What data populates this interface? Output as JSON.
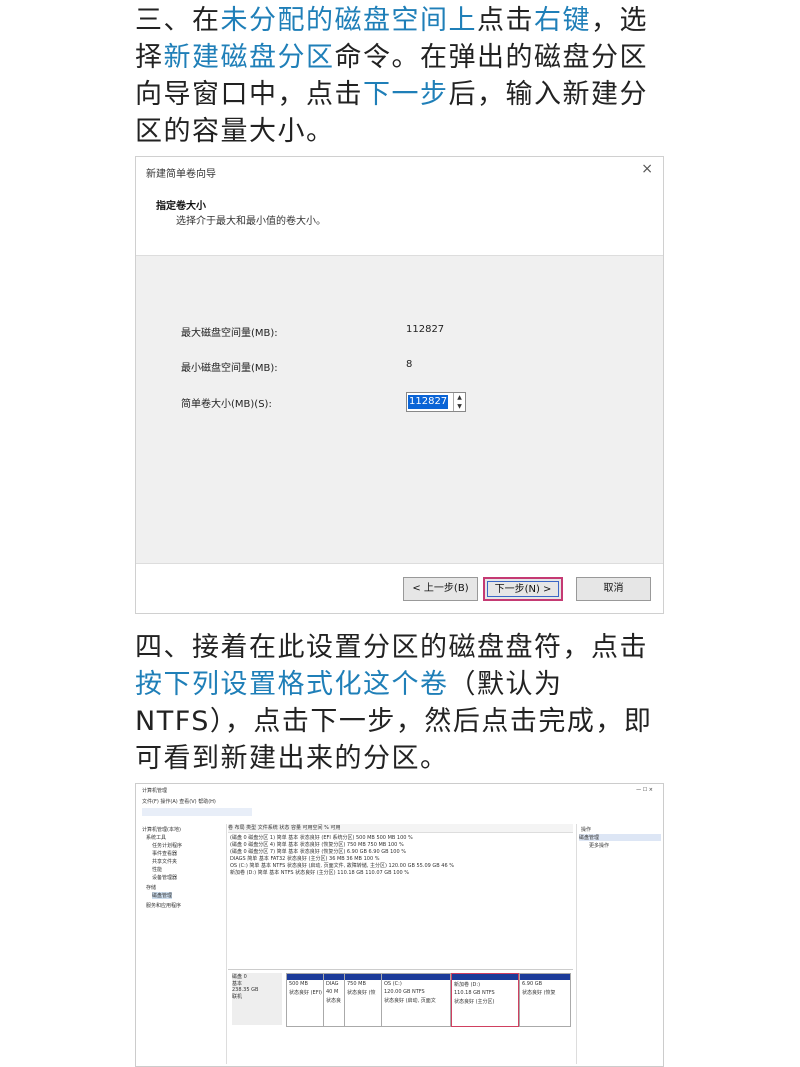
{
  "para1": {
    "s1": "三、在",
    "h1": "未分配的磁盘空间上",
    "s2": "点击",
    "h2": "右键",
    "s3": "，选择",
    "h3": "新建磁盘分区",
    "s4": "命令。在弹出的磁盘分区向导窗口中，点击",
    "h4": "下一步",
    "s5": "后，输入新建分区的容量大小。"
  },
  "dialog": {
    "title": "新建简单卷向导",
    "close": "×",
    "heading": "指定卷大小",
    "desc": "选择介于最大和最小值的卷大小。",
    "max_label": "最大磁盘空间量(MB):",
    "max_value": "112827",
    "min_label": "最小磁盘空间量(MB):",
    "min_value": "8",
    "size_label": "简单卷大小(MB)(S):",
    "size_value": "112827",
    "back": "< 上一步(B)",
    "next": "下一步(N) >",
    "cancel": "取消"
  },
  "para2": {
    "s1": "四、接着在此设置分区的磁盘盘符，点击",
    "h1": "按下列设置格式化这个卷",
    "s2": "（默认为NTFS），点击下一步，然后点击完成，即可看到新建出来的分区。"
  },
  "diskmgmt": {
    "title": "计算机管理",
    "menu": "文件(F)  操作(A)  查看(V)  帮助(H)",
    "tree": [
      "计算机管理(本地)",
      "系统工具",
      "任务计划程序",
      "事件查看器",
      "共享文件夹",
      "性能",
      "设备管理器",
      "存储",
      "磁盘管理",
      "服务和应用程序"
    ],
    "cols": "卷  布局  类型  文件系统  状态  容量  可用空间  % 可用",
    "rows": [
      "(磁盘 0 磁盘分区 1)  简单  基本    状态良好 (EFI 系统分区)  500 MB  500 MB  100 %",
      "(磁盘 0 磁盘分区 4)  简单  基本    状态良好 (恢复分区)  750 MB  750 MB  100 %",
      "(磁盘 0 磁盘分区 7)  简单  基本    状态良好 (恢复分区)  6.90 GB  6.90 GB  100 %",
      "DIAGS  简单  基本  FAT32  状态良好 (主分区)  36 MB  36 MB  100 %",
      "OS (C:)  简单  基本  NTFS  状态良好 (启动, 页面文件, 故障转储, 主分区)  120.00 GB  55.09 GB  46 %",
      "新加卷 (D:)  简单  基本  NTFS  状态良好 (主分区)  110.18 GB  110.07 GB  100 %"
    ],
    "actions_title": "操作",
    "actions_item": "磁盘管理",
    "actions_more": "更多操作",
    "disk": {
      "name": "磁盘 0",
      "type": "基本",
      "size": "238.35 GB",
      "status": "联机"
    },
    "parts": [
      {
        "name": "",
        "size": "500 MB",
        "st": "状态良好 (EFI)"
      },
      {
        "name": "DIAG",
        "size": "40 M",
        "st": "状态良"
      },
      {
        "name": "",
        "size": "750 MB",
        "st": "状态良好 (恢"
      },
      {
        "name": "OS (C:)",
        "size": "120.00 GB NTFS",
        "st": "状态良好 (启动, 页面文"
      },
      {
        "name": "新加卷 (D:)",
        "size": "110.18 GB NTFS",
        "st": "状态良好 (主分区)"
      },
      {
        "name": "",
        "size": "6.90 GB",
        "st": "状态良好 (恢复"
      }
    ],
    "window_ctrl": "—   ☐   ×"
  }
}
